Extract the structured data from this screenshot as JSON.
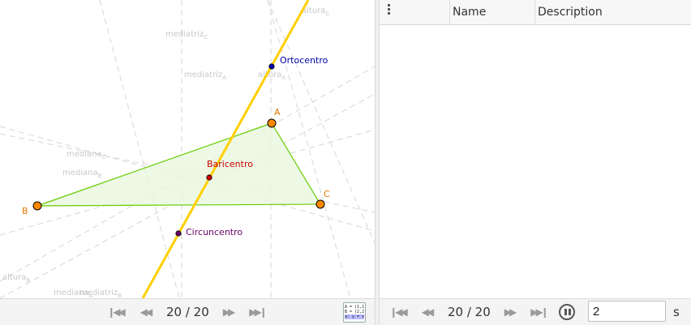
{
  "graphics": {
    "points": {
      "A": {
        "label": "A",
        "color": "#e07b00"
      },
      "B": {
        "label": "B",
        "color": "#e07b00"
      },
      "C": {
        "label": "C",
        "color": "#e07b00"
      }
    },
    "centers": {
      "ortocentro": {
        "label": "Ortocentro",
        "color": "#0000aa"
      },
      "baricentro": {
        "label": "Baricentro",
        "color": "#cc0000"
      },
      "circuncentro": {
        "label": "Circuncentro",
        "color": "#660066"
      }
    },
    "faint_labels": {
      "mediatriz_c": {
        "base": "mediatriz",
        "sub": "C"
      },
      "mediatriz_a": {
        "base": "mediatriz",
        "sub": "A"
      },
      "mediatriz_b": {
        "base": "mediatriz",
        "sub": "B"
      },
      "altura_c": {
        "base": "altura",
        "sub": "C"
      },
      "altura_a": {
        "base": "altura",
        "sub": "A"
      },
      "altura_b": {
        "base": "altura",
        "sub": "B"
      },
      "mediana_c": {
        "base": "mediana",
        "sub": "C"
      },
      "mediana_b": {
        "base": "mediana",
        "sub": "B"
      },
      "mediana_a": {
        "base": "mediana",
        "sub": "A"
      }
    },
    "colors": {
      "triangle_stroke": "#66cc00",
      "triangle_fill": "#eaf7e0",
      "euler_line": "#ffd000"
    }
  },
  "nav_left": {
    "first_icon": "skip-first-icon",
    "prev_icon": "step-back-icon",
    "step_text": "20 / 20",
    "next_icon": "step-forward-icon",
    "last_icon": "skip-last-icon",
    "algebra_toggle": {
      "line1": "A = (1,1)",
      "line2": "B = (2,2)",
      "line3": "a: y = x"
    }
  },
  "construction_protocol": {
    "menu_icon": "vertical-dots-icon",
    "columns": [
      "Name",
      "Description"
    ],
    "rows": []
  },
  "nav_right": {
    "step_text": "20 / 20",
    "pause_icon": "pause-icon",
    "speed_value": "2",
    "speed_unit": "s"
  }
}
